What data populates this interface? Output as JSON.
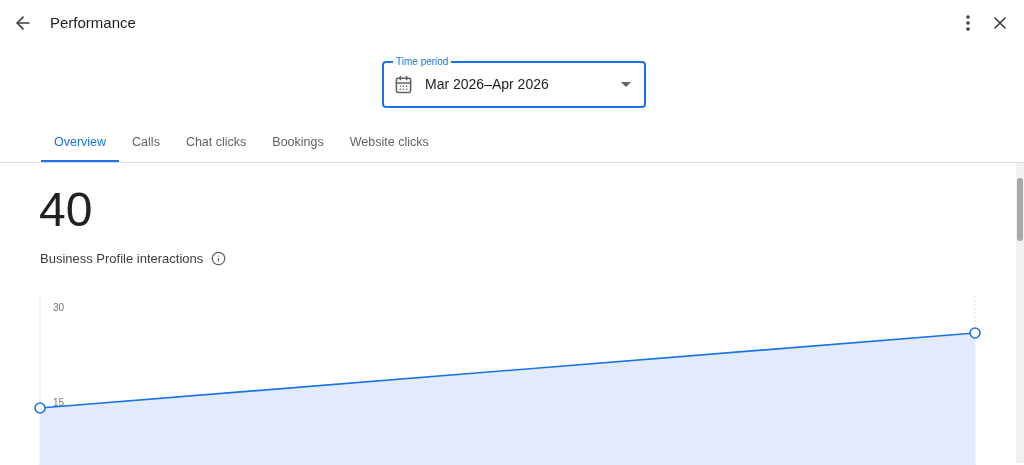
{
  "header": {
    "title": "Performance"
  },
  "time_period": {
    "label": "Time period",
    "value": "Mar 2026–Apr 2026"
  },
  "tabs": [
    {
      "label": "Overview",
      "selected": true
    },
    {
      "label": "Calls",
      "selected": false
    },
    {
      "label": "Chat clicks",
      "selected": false
    },
    {
      "label": "Bookings",
      "selected": false
    },
    {
      "label": "Website clicks",
      "selected": false
    }
  ],
  "summary": {
    "value": "40",
    "label": "Business Profile interactions"
  },
  "chart": {
    "y_axis_labels": [
      "30",
      "15"
    ]
  }
}
